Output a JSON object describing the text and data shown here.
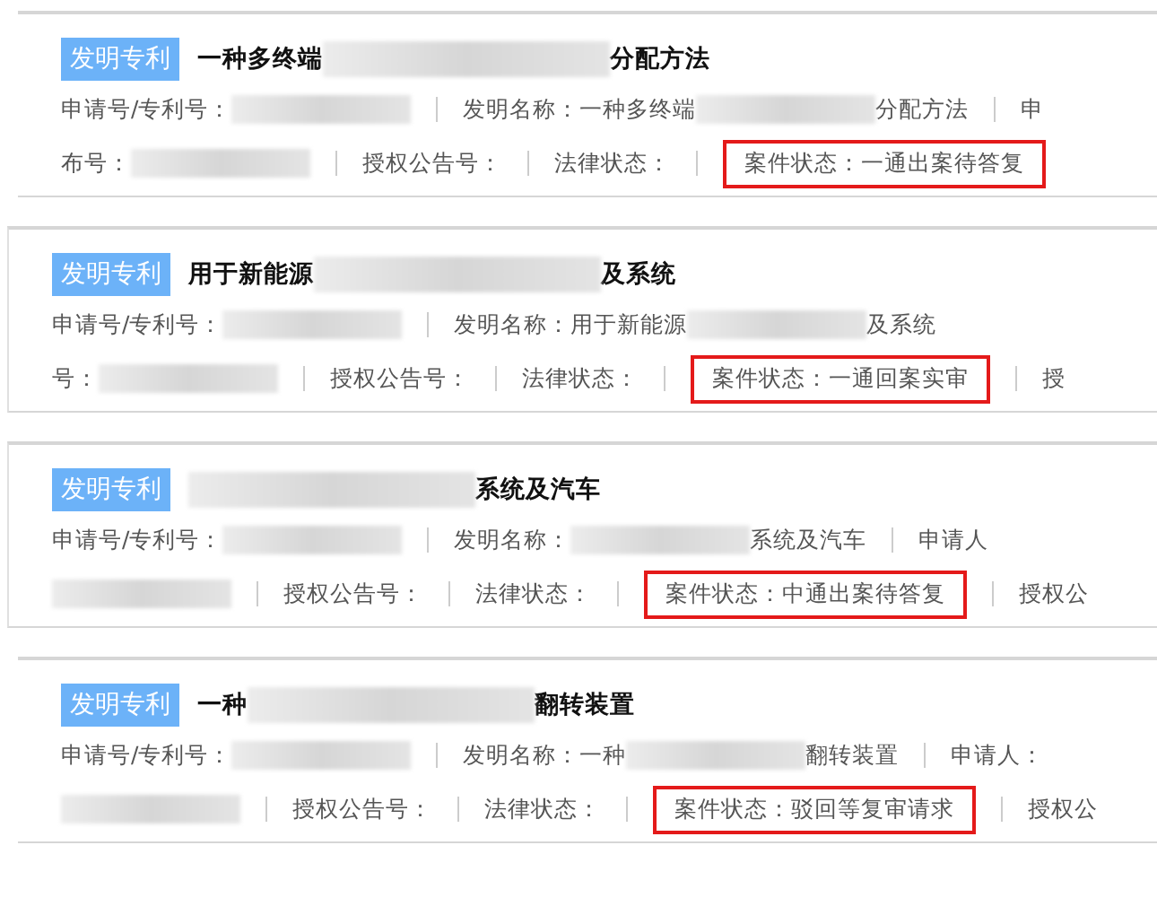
{
  "cards": [
    {
      "tag": "发明专利",
      "title_start": "一种多终端",
      "title_redacted": true,
      "title_end": "分配方法",
      "upper_line": [
        {
          "label": "申请号/专利号：",
          "redacted": true
        },
        {
          "label": "发明名称：",
          "value_start": "一种多终端",
          "redacted": true,
          "value_end": "分配方法"
        },
        {
          "label": "申"
        }
      ],
      "lower_line": [
        {
          "label": "布号：",
          "redacted": true
        },
        {
          "label": "授权公告号："
        },
        {
          "label": "法律状态："
        },
        {
          "label": "案件状态：",
          "value_start": "一通出案待答复",
          "highlighted": true
        }
      ]
    },
    {
      "tag": "发明专利",
      "title_start": "用于新能源",
      "title_redacted": true,
      "title_end": "及系统",
      "upper_line": [
        {
          "label": "申请号/专利号：",
          "redacted": true
        },
        {
          "label": "发明名称：",
          "value_start": "用于新能源",
          "redacted": true,
          "value_end": "及系统"
        }
      ],
      "lower_line": [
        {
          "label": "号：",
          "redacted": true
        },
        {
          "label": "授权公告号："
        },
        {
          "label": "法律状态："
        },
        {
          "label": "案件状态：",
          "value_start": "一通回案实审",
          "highlighted": true
        },
        {
          "label": "授"
        }
      ]
    },
    {
      "tag": "发明专利",
      "title_redacted": true,
      "title_end": "系统及汽车",
      "upper_line": [
        {
          "label": "申请号/专利号：",
          "redacted": true
        },
        {
          "label": "发明名称：",
          "redacted": true,
          "value_end": "系统及汽车"
        },
        {
          "label": "申请人"
        }
      ],
      "lower_line": [
        {
          "redacted": true
        },
        {
          "label": "授权公告号："
        },
        {
          "label": "法律状态："
        },
        {
          "label": "案件状态：",
          "value_start": "中通出案待答复",
          "highlighted": true
        },
        {
          "label": "授权公"
        }
      ]
    },
    {
      "tag": "发明专利",
      "title_start": "一种",
      "title_redacted": true,
      "title_end": "翻转装置",
      "upper_line": [
        {
          "label": "申请号/专利号：",
          "redacted": true
        },
        {
          "label": "发明名称：",
          "value_start": "一种",
          "redacted": true,
          "value_end": "翻转装置"
        },
        {
          "label": "申请人："
        }
      ],
      "lower_line": [
        {
          "redacted": true
        },
        {
          "label": "授权公告号："
        },
        {
          "label": "法律状态："
        },
        {
          "label": "案件状态：",
          "value_start": "驳回等复审请求",
          "highlighted": true
        },
        {
          "label": "授权公"
        }
      ]
    }
  ]
}
